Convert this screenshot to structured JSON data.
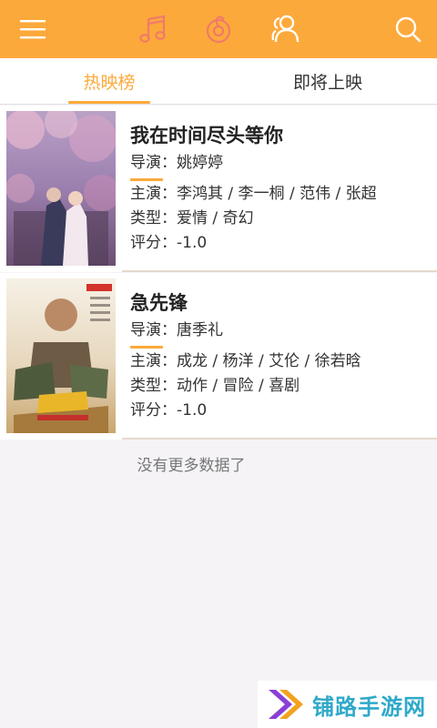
{
  "appbar": {
    "icons": [
      "menu-icon",
      "music-note-icon",
      "radio-icon",
      "people-icon",
      "search-icon"
    ],
    "colors": {
      "background": "#fca93b",
      "inactive_icon": "#f07a6a",
      "active_icon": "#ffffff"
    }
  },
  "tabs": [
    {
      "label": "热映榜",
      "active": true
    },
    {
      "label": "即将上映",
      "active": false
    }
  ],
  "movies": [
    {
      "title": "我在时间尽头等你",
      "director_label": "导演：",
      "director": "姚婷婷",
      "cast_label": "主演：",
      "cast": "李鸿其 / 李一桐 / 范伟 / 张超",
      "genre_label": "类型：",
      "genre": "爱情 / 奇幻",
      "rating_label": "评分：",
      "rating": "-1.0"
    },
    {
      "title": "急先锋",
      "director_label": "导演：",
      "director": "唐季礼",
      "cast_label": "主演：",
      "cast": "成龙 / 杨洋 / 艾伦 / 徐若晗",
      "genre_label": "类型：",
      "genre": "动作 / 冒险 / 喜剧",
      "rating_label": "评分：",
      "rating": "-1.0"
    }
  ],
  "footer": {
    "no_more": "没有更多数据了"
  },
  "watermark": {
    "text": "铺路手游网"
  },
  "accent_color": "#fca93b"
}
